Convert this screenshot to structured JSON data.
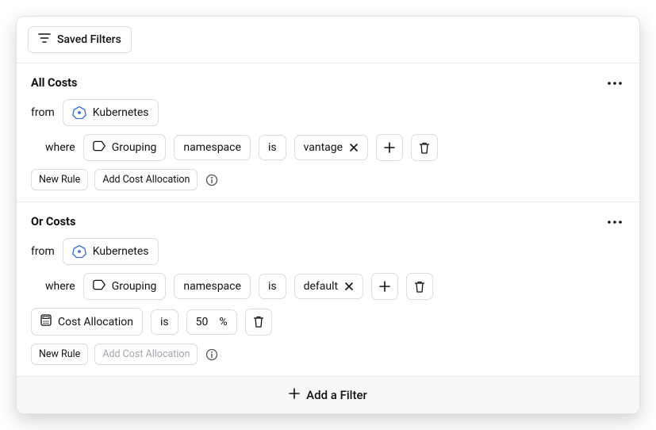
{
  "topbar": {
    "saved_filters_label": "Saved Filters"
  },
  "sections": [
    {
      "title": "All Costs",
      "from_label": "from",
      "provider": "Kubernetes",
      "where_label": "where",
      "grouping_label": "Grouping",
      "field": "namespace",
      "operator": "is",
      "value": "vantage",
      "has_cost_allocation": false,
      "actions": {
        "new_rule": "New Rule",
        "add_cost_allocation": "Add Cost Allocation",
        "add_cost_allocation_disabled": false
      }
    },
    {
      "title": "Or Costs",
      "from_label": "from",
      "provider": "Kubernetes",
      "where_label": "where",
      "grouping_label": "Grouping",
      "field": "namespace",
      "operator": "is",
      "value": "default",
      "has_cost_allocation": true,
      "cost_allocation": {
        "label": "Cost Allocation",
        "operator": "is",
        "value": "50",
        "suffix": "%"
      },
      "actions": {
        "new_rule": "New Rule",
        "add_cost_allocation": "Add Cost Allocation",
        "add_cost_allocation_disabled": true
      }
    }
  ],
  "footer": {
    "add_filter_label": "Add a Filter"
  }
}
